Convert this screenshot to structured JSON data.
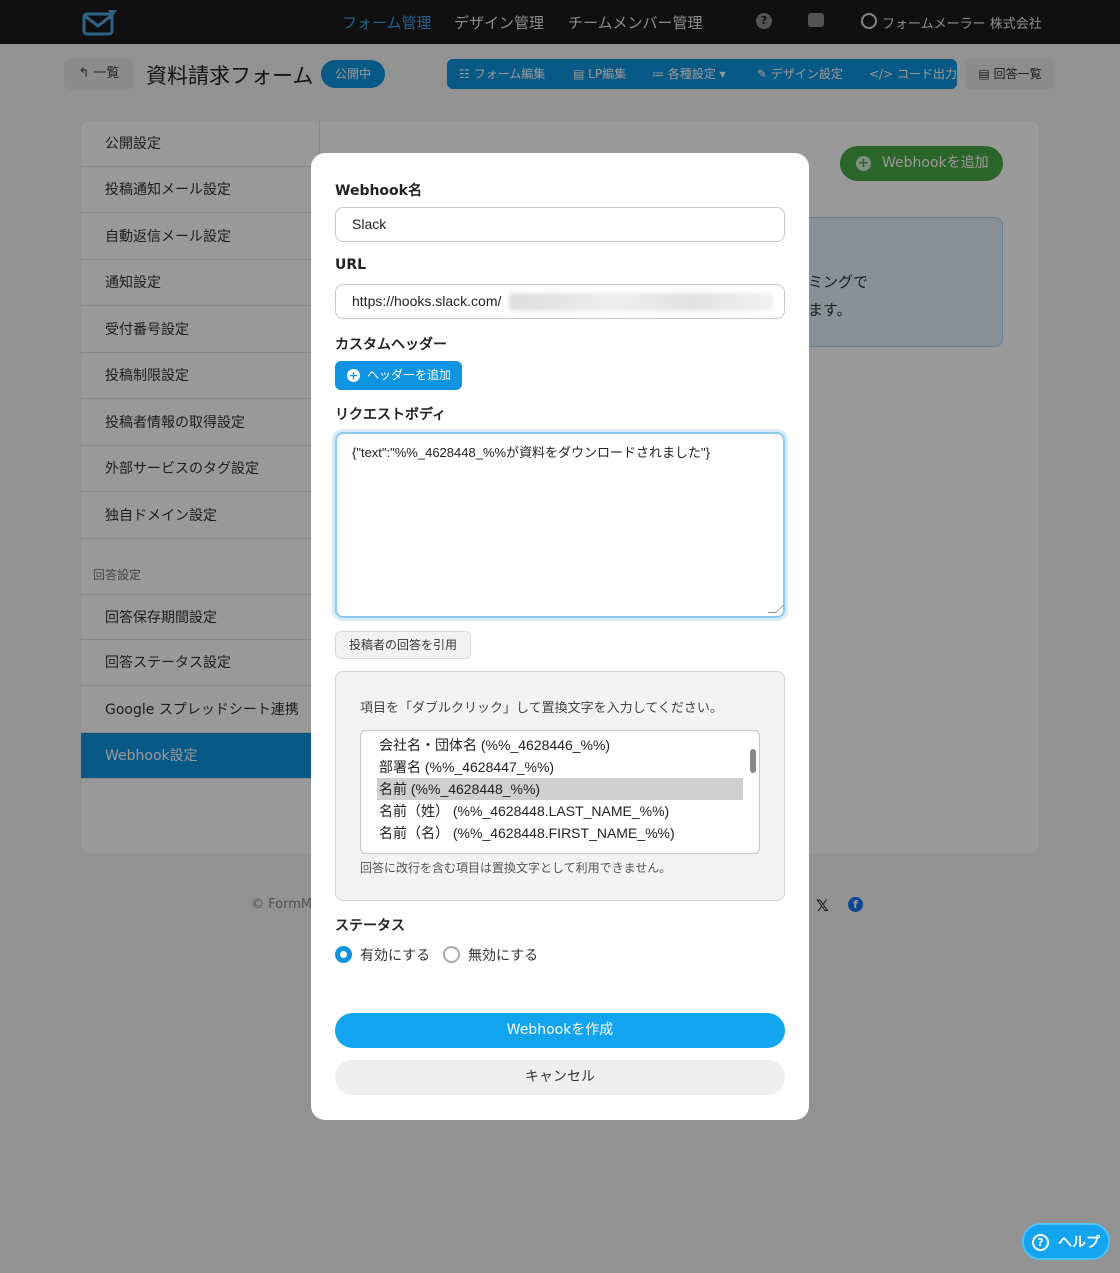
{
  "nav": {
    "items": [
      "フォーム管理",
      "デザイン管理",
      "チームメンバー管理"
    ],
    "help_icon": "?",
    "user": "フォームメーラー 株式会社"
  },
  "header": {
    "back_label": "↰ 一覧",
    "title": "資料請求フォーム",
    "status": "公開中",
    "toolbar": [
      "☷ フォーム編集",
      "▤ LP編集",
      "≔ 各種設定 ▾",
      "✎ デザイン設定",
      "</> コード出力"
    ],
    "answers": "▤ 回答一覧"
  },
  "sidebar": {
    "items": [
      "公開設定",
      "投稿通知メール設定",
      "自動返信メール設定",
      "通知設定",
      "受付番号設定",
      "投稿制限設定",
      "投稿者情報の取得設定",
      "外部サービスのタグ設定",
      "独自ドメイン設定"
    ],
    "section": "回答設定",
    "items2": [
      "回答保存期間設定",
      "回答ステータス設定",
      "Google スプレッドシート連携",
      "Webhook設定"
    ]
  },
  "main": {
    "add_webhook": "Webhookを追加",
    "info_line1": "イミングで",
    "info_line2": "きます。"
  },
  "footer": {
    "copyright": "© FormM"
  },
  "modal": {
    "name_label": "Webhook名",
    "name_value": "Slack",
    "url_label": "URL",
    "url_value": "https://hooks.slack.com/",
    "headers_label": "カスタムヘッダー",
    "add_header": "ヘッダーを追加",
    "body_label": "リクエストボディ",
    "body_value": "{\"text\":\"%%_4628448_%%が資料をダウンロードされました\"}",
    "quote_button": "投稿者の回答を引用",
    "var_hint": "項目を「ダブルクリック」して置換文字を入力してください。",
    "var_items": [
      "会社名・団体名 (%%_4628446_%%)",
      "部署名 (%%_4628447_%%)",
      "名前 (%%_4628448_%%)",
      "名前（姓） (%%_4628448.LAST_NAME_%%)",
      "名前（名） (%%_4628448.FIRST_NAME_%%)"
    ],
    "var_note": "回答に改行を含む項目は置換文字として利用できません。",
    "status_label": "ステータス",
    "status_on": "有効にする",
    "status_off": "無効にする",
    "create_button": "Webhookを作成",
    "cancel_button": "キャンセル"
  },
  "help_button": "ヘルプ",
  "colors": {
    "accent": "#0e94e0",
    "success": "#4aa846",
    "nav_bg": "#1c1c1c"
  }
}
